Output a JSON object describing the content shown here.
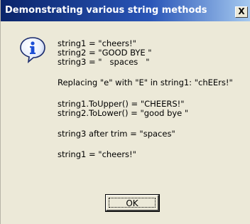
{
  "dialog": {
    "title": "Demonstrating various string methods",
    "close_label": "X",
    "icon": "info-icon",
    "ok_label": "OK"
  },
  "message": {
    "string1": "string1 = \"cheers!\"",
    "string2": "string2 = \"GOOD BYE \"",
    "string3": "string3 = \"   spaces   \"",
    "replace": "Replacing \"e\" with \"E\" in string1: \"chEErs!\"",
    "upper": "string1.ToUpper() = \"CHEERS!\"",
    "lower": "string2.ToLower() = \"good bye \"",
    "trim": "string3 after trim = \"spaces\"",
    "final": "string1 = \"cheers!\""
  },
  "colors": {
    "titlebar_start": "#0a246a",
    "titlebar_end": "#a6caf0",
    "dialog_bg": "#ece9d8",
    "icon_blue": "#1c4ed6"
  }
}
